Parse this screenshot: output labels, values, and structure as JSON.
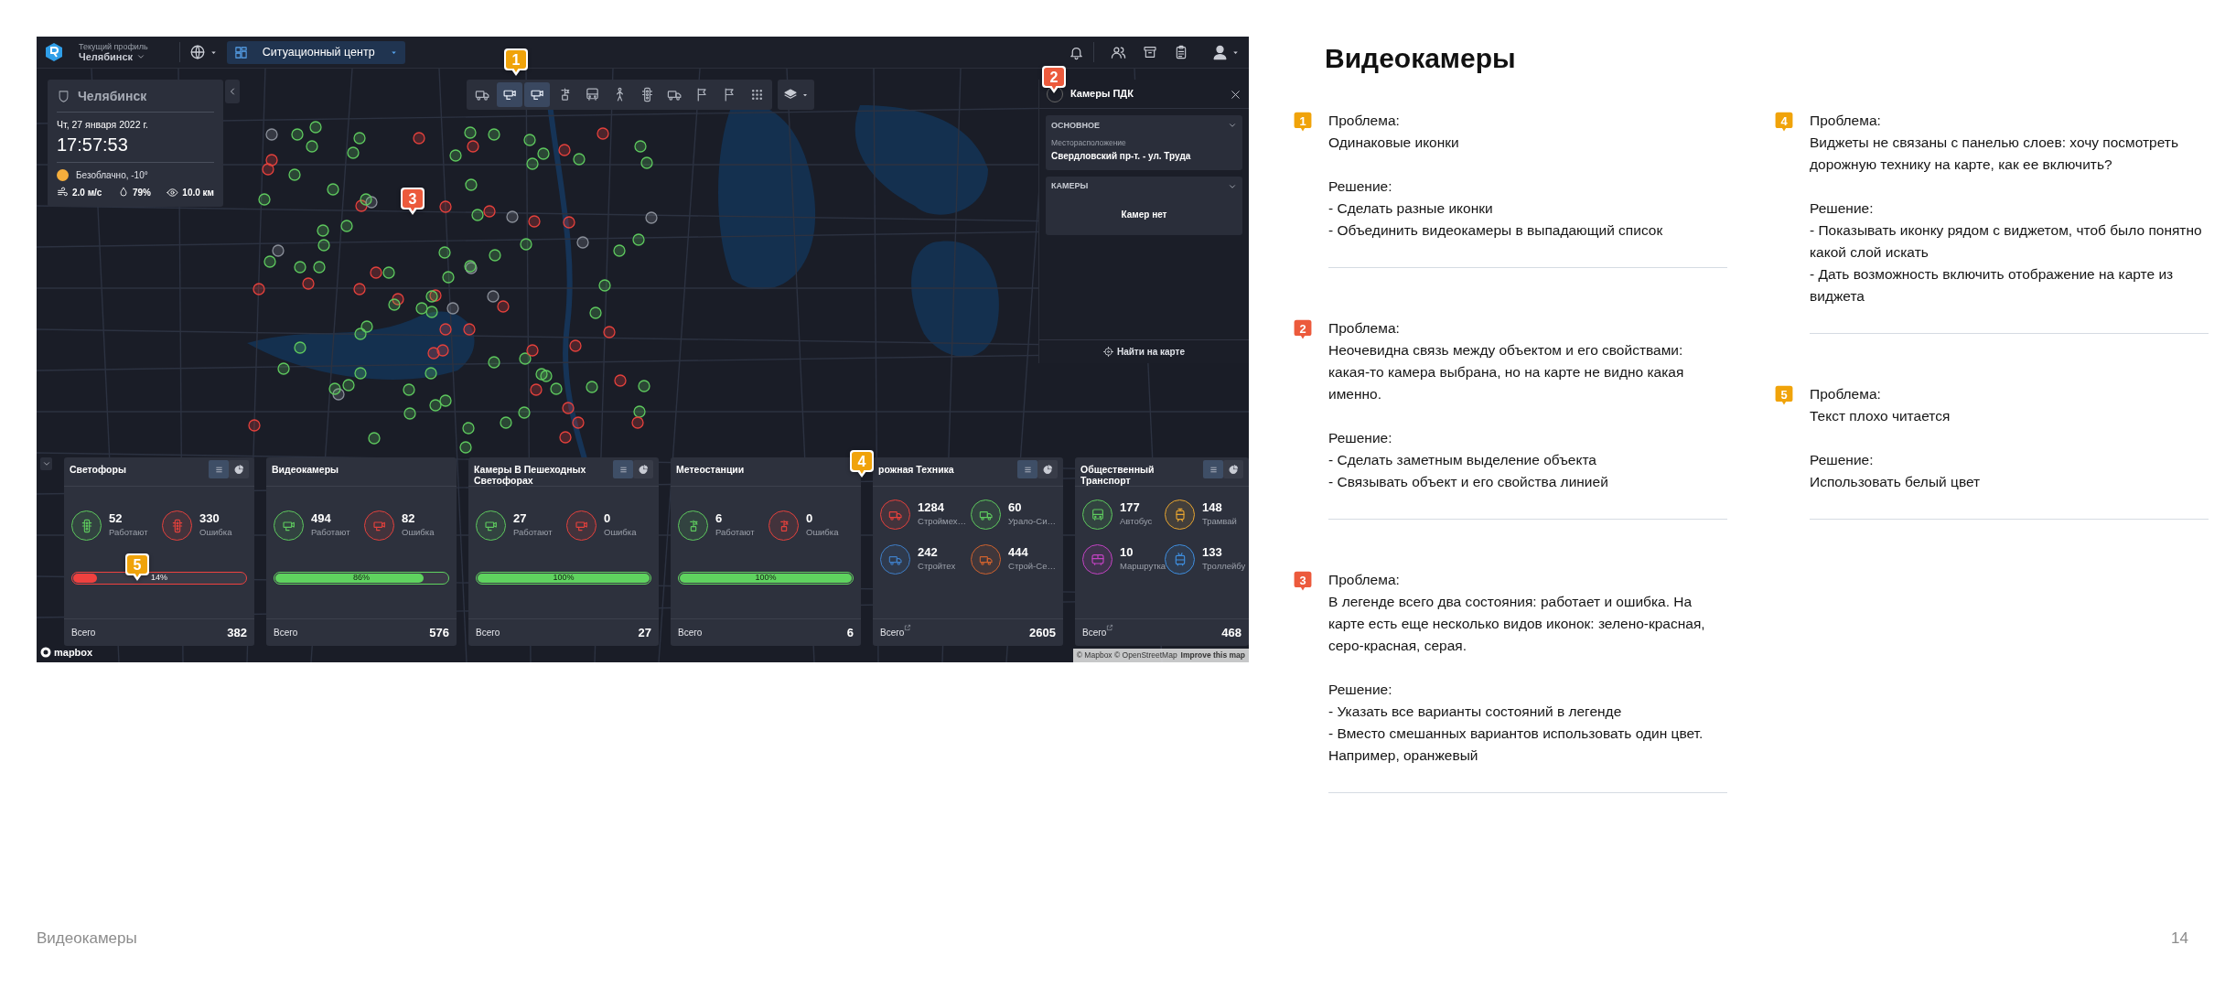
{
  "app": {
    "navbar": {
      "profile_label": "Текущий профиль",
      "profile_value": "Челябинск",
      "section_button": "Ситуационный центр"
    },
    "info_panel": {
      "city": "Челябинск",
      "date": "Чт, 27 января 2022 г.",
      "time": "17:57:53",
      "weather": "Безоблачно, -10°",
      "wind": "2.0 м/с",
      "humidity": "79%",
      "visibility": "10.0 км"
    },
    "layer_toolbar": [
      {
        "kind": "truck",
        "selected": false
      },
      {
        "kind": "camera",
        "selected": true
      },
      {
        "kind": "camera",
        "selected": true
      },
      {
        "kind": "weather-station",
        "selected": false
      },
      {
        "kind": "bus",
        "selected": false
      },
      {
        "kind": "pedestrian",
        "selected": false
      },
      {
        "kind": "traffic-light",
        "selected": false
      },
      {
        "kind": "truck",
        "selected": false
      },
      {
        "kind": "flag",
        "selected": false
      },
      {
        "kind": "flag",
        "selected": false
      },
      {
        "kind": "grid",
        "selected": false
      }
    ],
    "details_panel": {
      "title": "Камеры ПДК",
      "sections": [
        {
          "heading": "ОСНОВНОЕ",
          "field_label": "Месторасположение",
          "field_value": "Свердловский пр-т. - ул. Труда"
        },
        {
          "heading": "КАМЕРЫ",
          "empty_text": "Камер нет"
        }
      ],
      "find_button": "Найти на карте"
    },
    "widgets": [
      {
        "title": "Светофоры",
        "toggles": [
          {
            "kind": "list",
            "selected": true
          },
          {
            "kind": "pie",
            "selected": false
          }
        ],
        "stats": [
          {
            "kind": "traffic-light",
            "color": "#5ec95e",
            "value": "52",
            "label": "Работают"
          },
          {
            "kind": "traffic-light",
            "color": "#e5413c",
            "value": "330",
            "label": "Ошибка"
          }
        ],
        "progress": {
          "level": 0.14,
          "label": "14%",
          "color": "#f0413f"
        },
        "total_label": "Всего",
        "total": "382",
        "external_link": false
      },
      {
        "title": "Видеокамеры",
        "stats": [
          {
            "kind": "camera",
            "color": "#5ec95e",
            "value": "494",
            "label": "Работают"
          },
          {
            "kind": "camera",
            "color": "#e5413c",
            "value": "82",
            "label": "Ошибка"
          }
        ],
        "progress": {
          "level": 0.86,
          "label": "86%",
          "color": "#5fd35f"
        },
        "total_label": "Всего",
        "total": "576",
        "external_link": false
      },
      {
        "title": "Камеры В Пешеходных Светофорах",
        "toggles": [
          {
            "kind": "list",
            "selected": true
          },
          {
            "kind": "pie",
            "selected": false
          }
        ],
        "stats": [
          {
            "kind": "camera",
            "color": "#5ec95e",
            "value": "27",
            "label": "Работают"
          },
          {
            "kind": "camera",
            "color": "#e5413c",
            "value": "0",
            "label": "Ошибка"
          }
        ],
        "progress": {
          "level": 1,
          "label": "100%",
          "color": "#5fd35f"
        },
        "total_label": "Всего",
        "total": "27",
        "external_link": false
      },
      {
        "title": "Метеостанции",
        "stats": [
          {
            "kind": "weather-station",
            "color": "#5ec95e",
            "value": "6",
            "label": "Работают"
          },
          {
            "kind": "weather-station",
            "color": "#e5413c",
            "value": "0",
            "label": "Ошибка"
          }
        ],
        "progress": {
          "level": 1,
          "label": "100%",
          "color": "#5fd35f"
        },
        "total_label": "Всего",
        "total": "6",
        "external_link": false
      },
      {
        "title": "рожная Техника",
        "toggles": [
          {
            "kind": "list",
            "selected": true
          },
          {
            "kind": "pie",
            "selected": false
          }
        ],
        "stats": [
          {
            "kind": "truck",
            "color": "#e5413c",
            "value": "1284",
            "label": "Строймех…"
          },
          {
            "kind": "truck",
            "color": "#5ec95e",
            "value": "60",
            "label": "Урало-Си…"
          },
          {
            "kind": "truck",
            "color": "#3f7fc8",
            "value": "242",
            "label": "Стройтех"
          },
          {
            "kind": "truck",
            "color": "#d0622e",
            "value": "444",
            "label": "Строй-Се…"
          }
        ],
        "total_label": "Всего",
        "total": "2605",
        "external_link": true
      },
      {
        "title": "Общественный Транспорт",
        "toggles": [
          {
            "kind": "list",
            "selected": true
          },
          {
            "kind": "pie",
            "selected": false
          }
        ],
        "stats": [
          {
            "kind": "bus",
            "color": "#5ec95e",
            "value": "177",
            "label": "Автобус"
          },
          {
            "kind": "tram",
            "color": "#e8a530",
            "value": "148",
            "label": "Трамвай"
          },
          {
            "kind": "minibus",
            "color": "#c443c4",
            "value": "10",
            "label": "Маршрутка"
          },
          {
            "kind": "trolleybus",
            "color": "#3f8fe0",
            "value": "133",
            "label": "Троллейбу"
          }
        ],
        "total_label": "Всего",
        "total": "468",
        "external_link": true
      }
    ],
    "attribution": {
      "logo": "mapbox",
      "credits": "© Mapbox © OpenStreetMap",
      "improve_link": "Improve this map"
    }
  },
  "markers": [
    {
      "number": "1",
      "color": "#f0a30a"
    },
    {
      "number": "2",
      "color": "#ec5a3c"
    },
    {
      "number": "3",
      "color": "#ec5a3c"
    },
    {
      "number": "4",
      "color": "#f0a30a"
    },
    {
      "number": "5",
      "color": "#f0a30a"
    }
  ],
  "notes": {
    "title": "Видеокамеры",
    "columns": [
      [
        {
          "number": "1",
          "color": "#f0a30a",
          "problem_label": "Проблема:",
          "problem": "Одинаковые иконки",
          "solution_label": "Решение:",
          "solution": [
            "- Сделать разные иконки",
            "- Объединить видеокамеры в выпадающий список"
          ]
        },
        {
          "number": "2",
          "color": "#ec5a3c",
          "problem_label": "Проблема:",
          "problem": "Неочевидна связь между объектом и его свойствами: какая-то камера выбрана, но на карте не видно какая именно.",
          "solution_label": "Решение:",
          "solution": [
            "- Сделать заметным выделение объекта",
            "- Связывать объект и его свойства линией"
          ]
        },
        {
          "number": "3",
          "color": "#ec5a3c",
          "problem_label": "Проблема:",
          "problem": "В легенде всего два состояния: работает и ошибка. На карте есть еще несколько видов иконок: зелено-красная, серо-красная, серая.",
          "solution_label": "Решение:",
          "solution": [
            "- Указать все варианты состояний в легенде",
            "- Вместо смешанных вариантов использовать один цвет. Например, оранжевый"
          ]
        }
      ],
      [
        {
          "number": "4",
          "color": "#f0a30a",
          "problem_label": "Проблема:",
          "problem": "Виджеты не связаны с панелью слоев: хочу посмотреть дорожную технику на карте, как ее включить?",
          "solution_label": "Решение:",
          "solution": [
            "- Показывать иконку рядом с виджетом, чтоб было понятно какой слой искать",
            "- Дать возможность включить отображение на карте из виджета"
          ]
        },
        {
          "number": "5",
          "color": "#f0a30a",
          "problem_label": "Проблема:",
          "problem": "Текст плохо читается",
          "solution_label": "Решение:",
          "solution": [
            "Использовать белый цвет"
          ]
        }
      ]
    ]
  },
  "footer": {
    "title": "Видеокамеры",
    "page": "14"
  }
}
